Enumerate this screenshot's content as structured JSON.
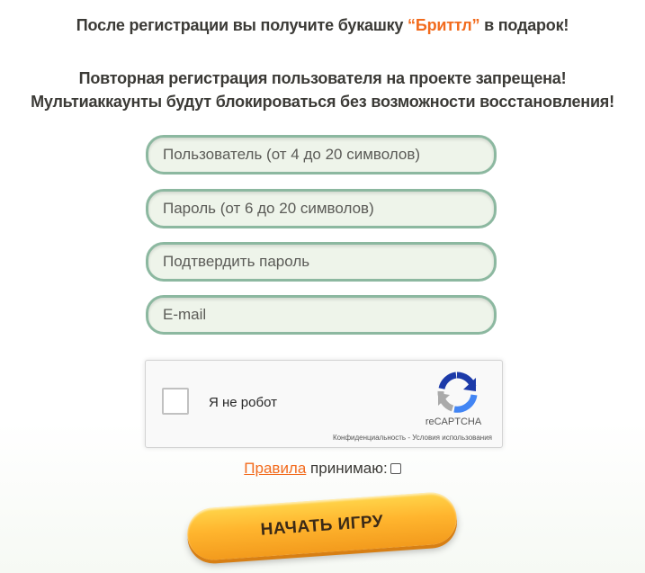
{
  "notice": {
    "gift_prefix": "После регистрации вы получите букашку ",
    "gift_name": "“Бриттл”",
    "gift_suffix": " в подарок!",
    "warning_line1": "Повторная регистрация пользователя на проекте запрещена!",
    "warning_line2": "Мультиаккаунты будут блокироваться без возможности восстановления!",
    "accent_color": "#f26b1d"
  },
  "form": {
    "username": {
      "placeholder": "Пользователь (от 4 до 20 символов)",
      "value": ""
    },
    "password": {
      "placeholder": "Пароль (от 6 до 20 символов)",
      "value": ""
    },
    "confirm_password": {
      "placeholder": "Подтвердить пароль",
      "value": ""
    },
    "email": {
      "placeholder": "E-mail",
      "value": ""
    }
  },
  "captcha": {
    "label": "Я не робот",
    "brand": "reCAPTCHA",
    "privacy": "Конфиденциальность",
    "separator": " - ",
    "terms": "Условия использования",
    "icon": "recaptcha-icon"
  },
  "rules": {
    "link_label": "Правила",
    "accept_label": " принимаю:"
  },
  "start_button": {
    "label": "НАЧАТЬ ИГРУ"
  }
}
